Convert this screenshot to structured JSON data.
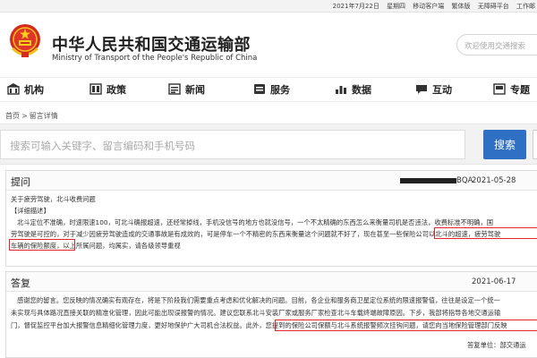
{
  "topbar": {
    "date": "2021年7月22日",
    "weekday": "星期四",
    "mobile": "移动客户端",
    "weibo": "繁体版",
    "accessible": "无障碍平台",
    "work": "工作邮"
  },
  "header": {
    "title_cn": "中华人民共和国交通运输部",
    "title_en": "Ministry of Transport of the People's Republic of China",
    "search_placeholder": "欢迎使用交通搜索"
  },
  "nav": [
    {
      "label": "机构",
      "icon": "building-icon"
    },
    {
      "label": "政策",
      "icon": "book-icon"
    },
    {
      "label": "新闻",
      "icon": "news-icon"
    },
    {
      "label": "服务",
      "icon": "service-icon"
    },
    {
      "label": "数据",
      "icon": "chart-icon"
    },
    {
      "label": "互动",
      "icon": "chat-icon"
    },
    {
      "label": "专题",
      "icon": "topic-icon"
    }
  ],
  "breadcrumb": {
    "home": "首页",
    "sep": ">",
    "current": "留言详情"
  },
  "search": {
    "placeholder": "搜索可输入关键字、留言编码和手机号码",
    "button": "搜索"
  },
  "question": {
    "heading": "提问",
    "id_tail": "BQA",
    "date": "2021-05-28",
    "subject": "关于疲劳驾驶，北斗收费问题",
    "detail_label": "【详细描述】",
    "line1": "北斗定位不准确，时速限速100，可北斗确报超速，还经常掉线，手机没信号的地方也就没信号，一个不太精确的东西怎么来衡量司机是否违法，收费标准不明确，国",
    "line2": "劳驾驶是可控的，对于减少因疲劳驾驶造成的交通事故是有成效的，可是停车一个不精密的东西来衡量这个问题就不好了，现在甚至一些保险公司以北斗的超速，疲劳驾驶",
    "line3_a": "车辆的保险额度，",
    "line3_b": "以上所属问题，均属实，请各级领导重视"
  },
  "answer": {
    "heading": "答复",
    "date": "2021-06-17",
    "line1": "感谢您的留言。您反映的情况确实有观存在，将是下阶段我们需要重点考虑和优化解决的问题。目前，各企业和服务商卫星定位系统的限速报警值，往往是设定一个统一",
    "line2": "未实现与具体路况直接关联的精准化管理，因此可能出现误报警的情况。建议您联系北斗安装厂家或服务厂家检查北斗车载终端故障原因。下步，我部将指导各地交通运输",
    "line3_a": "门，督促监控平台加大报警信息精细化管理力度，更好地保护广大司机合法权益。此外，",
    "line3_b": "您提到的保险公司保额与北斗系统报警频次挂钩问题，请您向当地保险管理部门反映",
    "footer": "答复单位：部交通运"
  }
}
